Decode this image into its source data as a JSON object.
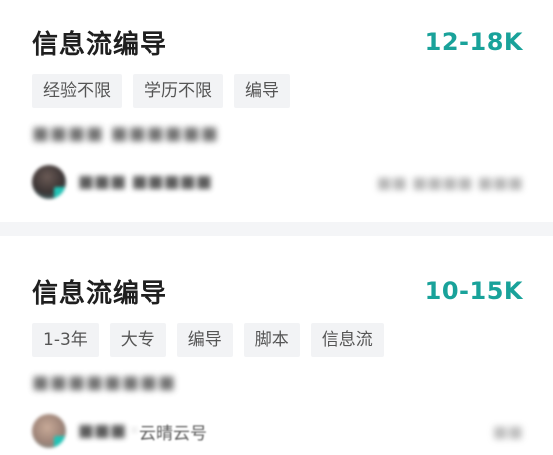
{
  "jobs": [
    {
      "title": "信息流编导",
      "salary": "12-18K",
      "tags": [
        "经验不限",
        "学历不限",
        "编导"
      ],
      "company": "",
      "recruiter": "",
      "location": ""
    },
    {
      "title": "信息流编导",
      "salary": "10-15K",
      "tags": [
        "1-3年",
        "大专",
        "编导",
        "脚本",
        "信息流"
      ],
      "company": "",
      "recruiter": "",
      "recruiter_role_visible": "云晴云号",
      "location": ""
    }
  ],
  "colors": {
    "salary": "#19a29a",
    "tag_bg": "#f2f3f5",
    "separator": "#f4f5f7"
  },
  "icons": {
    "avatar": "recruiter-avatar",
    "online": "online-status-icon"
  }
}
